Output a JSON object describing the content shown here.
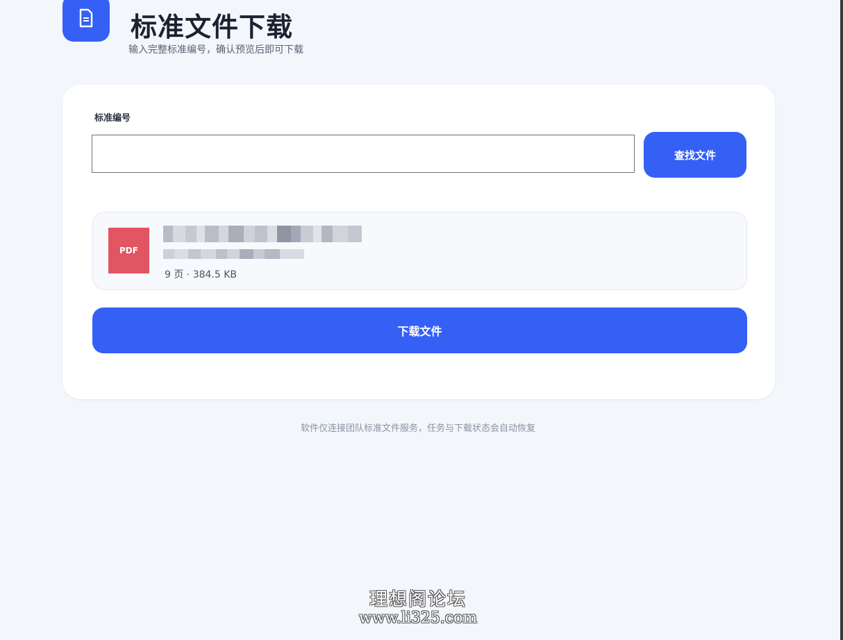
{
  "header": {
    "icon": "document-icon",
    "title": "标准文件下载",
    "subtitle": "输入完整标准编号，确认预览后即可下载"
  },
  "search": {
    "label": "标准编号",
    "value": "",
    "placeholder": "",
    "button_label": "查找文件"
  },
  "file": {
    "badge": "PDF",
    "meta": "9 页 · 384.5 KB"
  },
  "download": {
    "button_label": "下载文件"
  },
  "footer": {
    "note": "软件仅连接团队标准文件服务，任务与下载状态会自动恢复"
  },
  "watermark": {
    "line1": "理想阁论坛",
    "line2": "www.li325.com"
  },
  "colors": {
    "accent": "#3560f5",
    "pdf_badge": "#e25562",
    "background": "#f3f6fb"
  }
}
